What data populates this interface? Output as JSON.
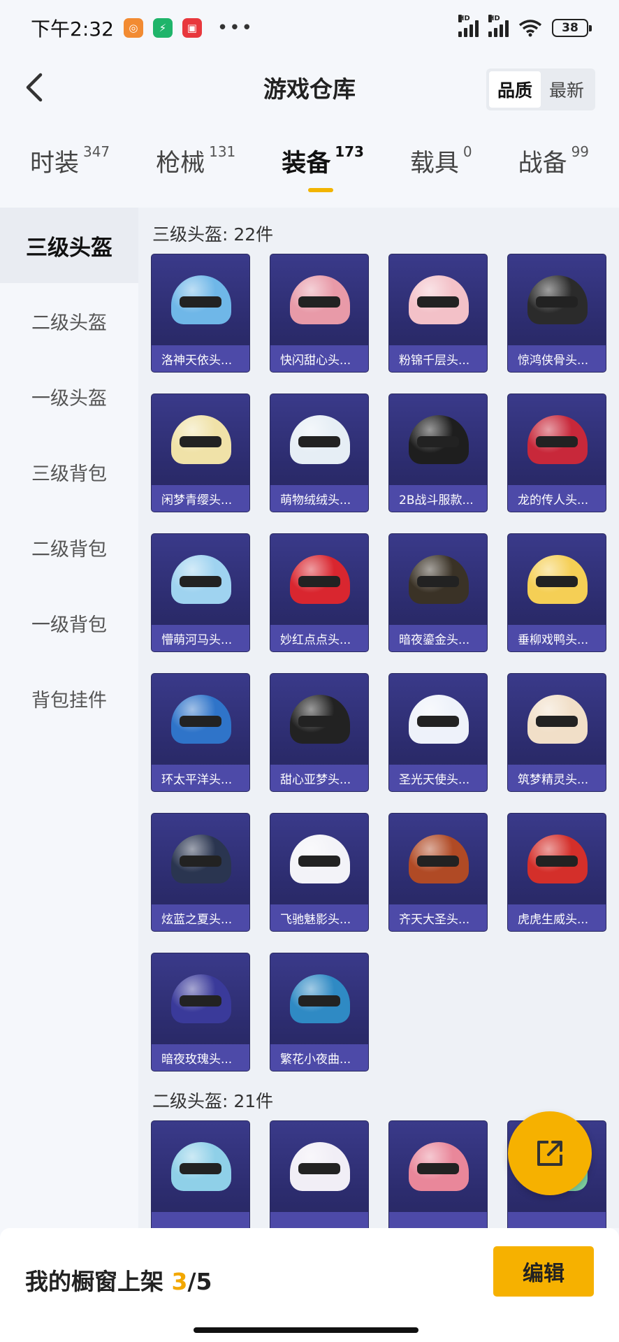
{
  "status_bar": {
    "time": "下午2:32",
    "battery": "38",
    "signal_label": "HD"
  },
  "header": {
    "title": "游戏仓库",
    "sort_options": [
      "品质",
      "最新"
    ],
    "sort_selected": "品质"
  },
  "tabs": [
    {
      "label": "时装",
      "count": "347",
      "active": false
    },
    {
      "label": "枪械",
      "count": "131",
      "active": false
    },
    {
      "label": "装备",
      "count": "173",
      "active": true
    },
    {
      "label": "载具",
      "count": "0",
      "active": false
    },
    {
      "label": "战备",
      "count": "99",
      "active": false
    }
  ],
  "sidebar": {
    "items": [
      {
        "label": "三级头盔",
        "active": true
      },
      {
        "label": "二级头盔",
        "active": false
      },
      {
        "label": "一级头盔",
        "active": false
      },
      {
        "label": "三级背包",
        "active": false
      },
      {
        "label": "二级背包",
        "active": false
      },
      {
        "label": "一级背包",
        "active": false
      },
      {
        "label": "背包挂件",
        "active": false
      }
    ]
  },
  "sections": [
    {
      "title": "三级头盔: 22件",
      "items": [
        {
          "name": "洛神天依头...",
          "color": "#6fb7e8"
        },
        {
          "name": "快闪甜心头...",
          "color": "#e89aa8"
        },
        {
          "name": "粉锦千层头...",
          "color": "#f3c1c8"
        },
        {
          "name": "惊鸿侠骨头...",
          "color": "#2b2b2b"
        },
        {
          "name": "闲梦青缨头...",
          "color": "#f0e2a8"
        },
        {
          "name": "萌物绒绒头...",
          "color": "#e6eef5"
        },
        {
          "name": "2B战斗服款...",
          "color": "#1e1e1e"
        },
        {
          "name": "龙的传人头...",
          "color": "#c8283a"
        },
        {
          "name": "懵萌河马头...",
          "color": "#9fd3f0"
        },
        {
          "name": "妙红点点头...",
          "color": "#d9262f"
        },
        {
          "name": "暗夜鎏金头...",
          "color": "#3a3226"
        },
        {
          "name": "垂柳戏鸭头...",
          "color": "#f5cf55"
        },
        {
          "name": "环太平洋头...",
          "color": "#2f74c9"
        },
        {
          "name": "甜心亚梦头...",
          "color": "#222222"
        },
        {
          "name": "圣光天使头...",
          "color": "#eef2fa"
        },
        {
          "name": "筑梦精灵头...",
          "color": "#f1dfc8"
        },
        {
          "name": "炫蓝之夏头...",
          "color": "#2a3550"
        },
        {
          "name": "飞驰魅影头...",
          "color": "#f3f3f8"
        },
        {
          "name": "齐天大圣头...",
          "color": "#b04a25"
        },
        {
          "name": "虎虎生威头...",
          "color": "#d42f2a"
        },
        {
          "name": "暗夜玫瑰头...",
          "color": "#3a3a9a"
        },
        {
          "name": "繁花小夜曲...",
          "color": "#2f8ac4"
        }
      ]
    },
    {
      "title": "二级头盔: 21件",
      "items": [
        {
          "name": "",
          "color": "#8fd0e8"
        },
        {
          "name": "",
          "color": "#f1eef6"
        },
        {
          "name": "",
          "color": "#e9879a"
        },
        {
          "name": "",
          "color": "#7fd0a0"
        }
      ]
    }
  ],
  "bottom_bar": {
    "label": "我的橱窗上架",
    "current": "3",
    "separator": "/",
    "total": "5",
    "edit_label": "编辑"
  },
  "colors": {
    "accent": "#f6b100",
    "card_bg": "#2c2c6e",
    "card_label_bg": "#4d4aa8"
  }
}
